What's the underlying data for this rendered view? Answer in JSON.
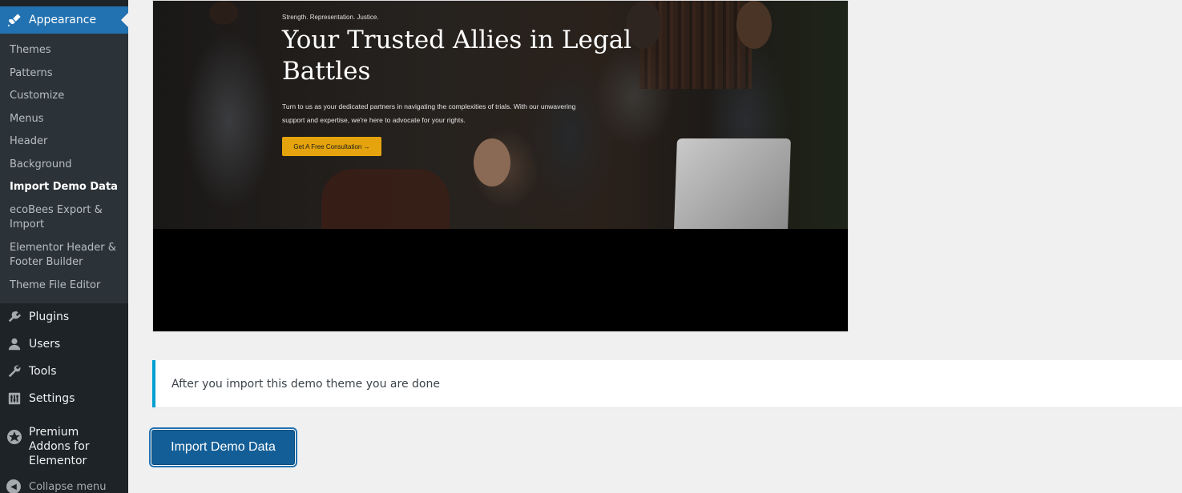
{
  "sidebar": {
    "current_menu": {
      "label": "Appearance",
      "icon": "paintbrush-icon"
    },
    "submenu": [
      {
        "label": "Themes"
      },
      {
        "label": "Patterns"
      },
      {
        "label": "Customize"
      },
      {
        "label": "Menus"
      },
      {
        "label": "Header"
      },
      {
        "label": "Background"
      },
      {
        "label": "Import Demo Data",
        "active": true
      },
      {
        "label": "ecoBees Export & Import"
      },
      {
        "label": "Elementor Header & Footer Builder"
      },
      {
        "label": "Theme File Editor"
      }
    ],
    "menus": [
      {
        "label": "Plugins",
        "icon": "plugins-icon"
      },
      {
        "label": "Users",
        "icon": "users-icon"
      },
      {
        "label": "Tools",
        "icon": "tools-icon"
      },
      {
        "label": "Settings",
        "icon": "settings-icon"
      }
    ],
    "premium": {
      "label": "Premium Addons for Elementor",
      "icon": "premium-addons-icon"
    },
    "collapse": {
      "label": "Collapse menu",
      "icon": "collapse-icon"
    }
  },
  "preview": {
    "eyebrow": "Strength. Representation. Justice.",
    "title": "Your Trusted Allies in Legal Battles",
    "text": "Turn to us as your dedicated partners in navigating the complexities of trials. With our unwavering support and expertise, we're here to advocate for your rights.",
    "button": "Get A Free Consultation →"
  },
  "notice": {
    "text": "After you import this demo theme you are done"
  },
  "import_button": {
    "label": "Import Demo Data"
  },
  "colors": {
    "sidebar_bg": "#1d2327",
    "submenu_bg": "#2c3338",
    "accent": "#2271b1",
    "button_bg": "#135e96",
    "hero_button": "#e5a40d"
  }
}
